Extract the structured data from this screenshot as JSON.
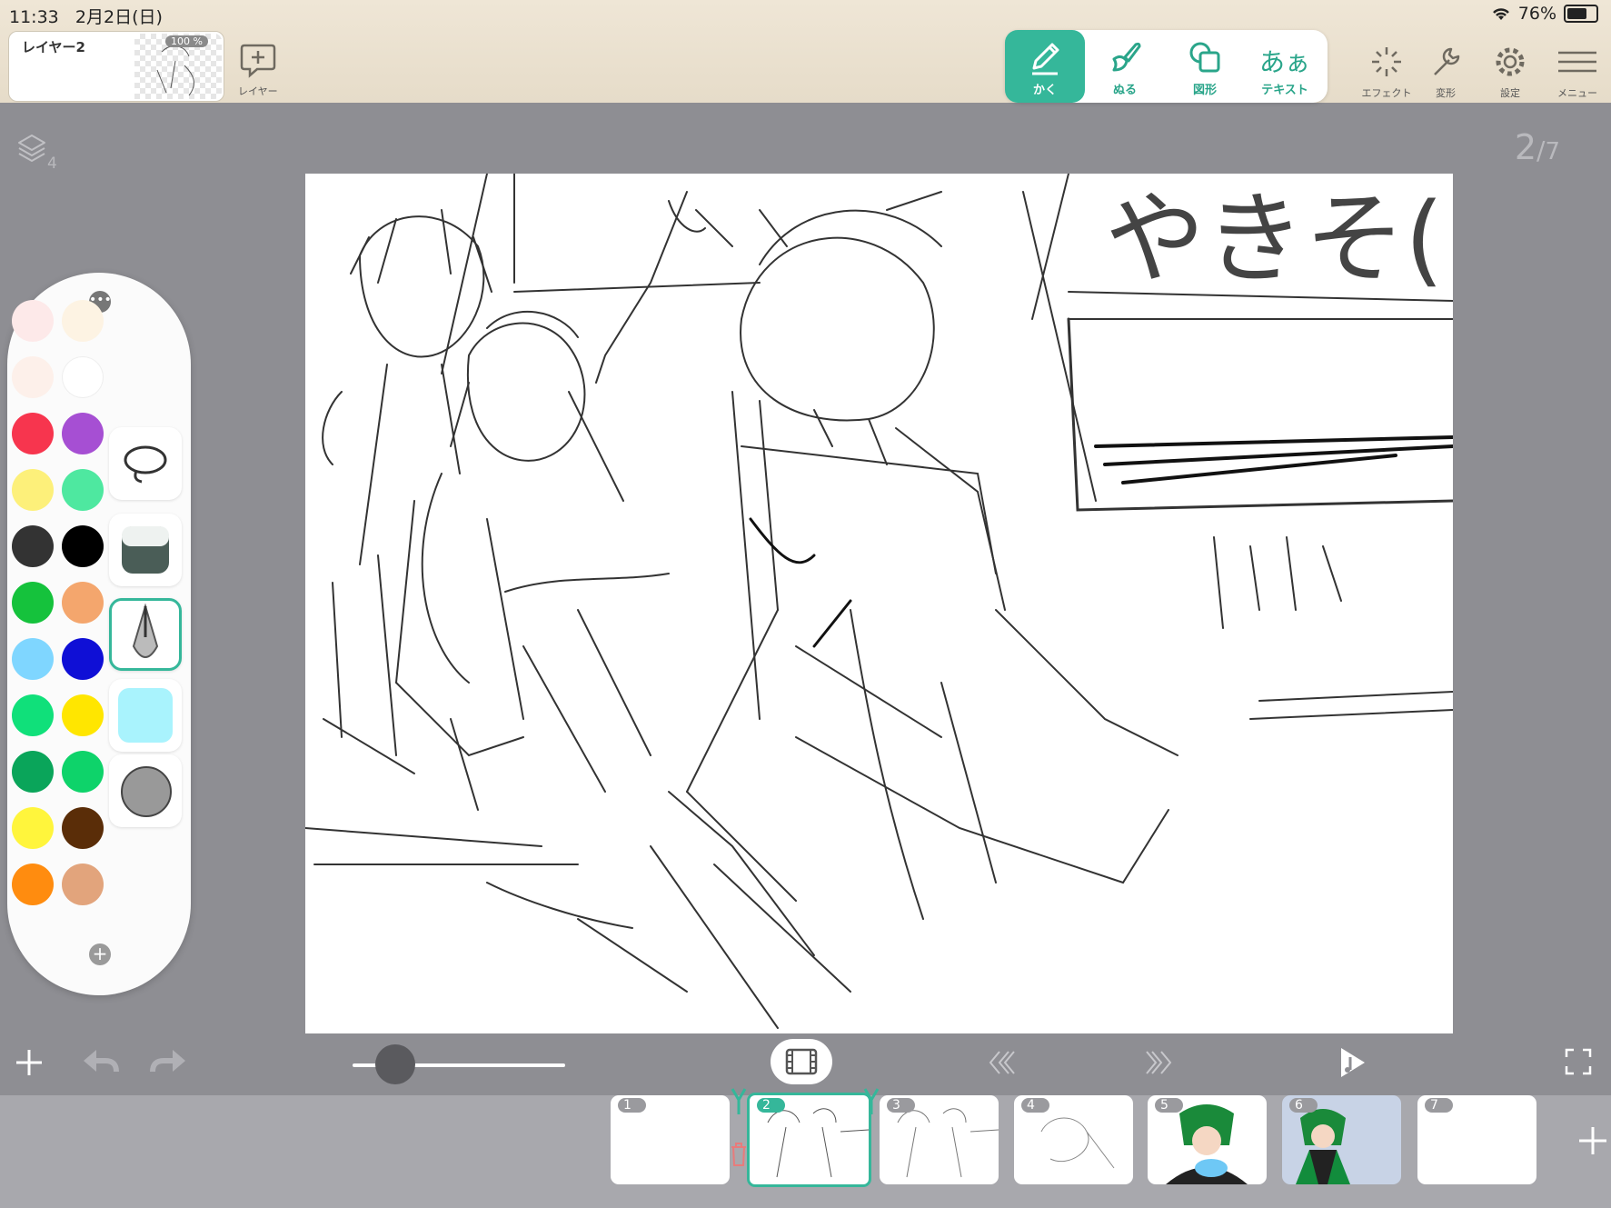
{
  "status": {
    "time": "11:33",
    "date": "2月2日(日)",
    "battery": "76%",
    "battery_level": 0.76
  },
  "layer_panel": {
    "name": "レイヤー2",
    "opacity": "100 %",
    "add_layer_label": "レイヤー"
  },
  "modes": [
    {
      "label": "かく",
      "icon": "pencil-icon",
      "active": true
    },
    {
      "label": "ぬる",
      "icon": "paint-brush-icon",
      "active": false
    },
    {
      "label": "図形",
      "icon": "shapes-icon",
      "active": false
    },
    {
      "label": "テキスト",
      "icon": "text-icon",
      "glyph": "あぁ",
      "active": false
    }
  ],
  "tools": [
    {
      "label": "エフェクト",
      "icon": "sparkle-icon"
    },
    {
      "label": "変形",
      "icon": "wrench-icon"
    },
    {
      "label": "設定",
      "icon": "gear-icon"
    },
    {
      "label": "メニュー",
      "icon": "hamburger-menu-icon"
    }
  ],
  "canvas": {
    "layers_count": "4",
    "page_current": "2",
    "page_total": "7",
    "sketch_text": "やきそ("
  },
  "palette": {
    "colors": [
      "#fde9e9",
      "#fdf3e3",
      "#fdf0ea",
      "#ffffff",
      "#f7354e",
      "#a64fd3",
      "#fdf07a",
      "#4ee8a0",
      "#333333",
      "#000000",
      "#15c23c",
      "#f4a66d",
      "#7fd6ff",
      "#0f0fd6",
      "#10e07a",
      "#ffe600",
      "#0aa55a",
      "#0ed36a",
      "#fff53c",
      "#5a2d08",
      "#ff8c0f",
      "#e2a47c"
    ],
    "current_color": "#a9f3fd",
    "brush_size_color": "#999999"
  },
  "timeline": {
    "slider_value": 0.2,
    "frames": [
      {
        "num": "1",
        "selected": false
      },
      {
        "num": "2",
        "selected": true
      },
      {
        "num": "3",
        "selected": false
      },
      {
        "num": "4",
        "selected": false
      },
      {
        "num": "5",
        "selected": false
      },
      {
        "num": "6",
        "selected": false
      },
      {
        "num": "7",
        "selected": false
      }
    ]
  }
}
